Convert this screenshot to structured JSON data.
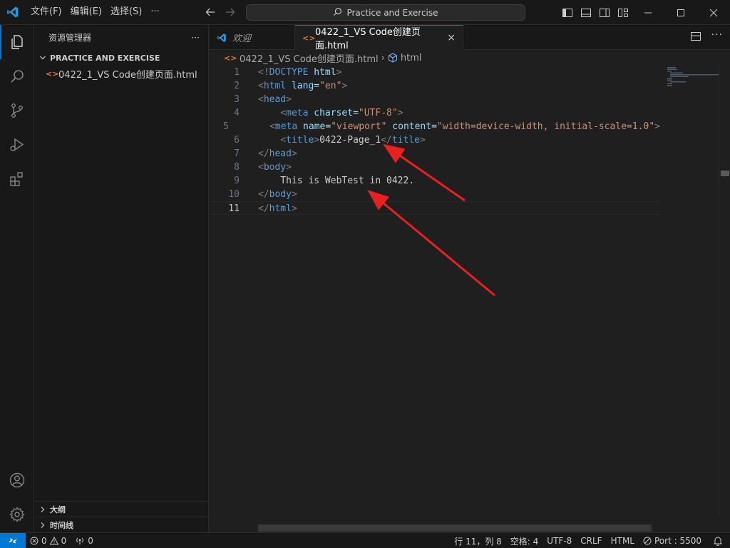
{
  "titlebar": {
    "menus": [
      "文件(F)",
      "编辑(E)",
      "选择(S)",
      "···"
    ],
    "search_text": "Practice and Exercise"
  },
  "sidebar": {
    "title": "资源管理器",
    "more": "···",
    "folder": "PRACTICE AND EXERCISE",
    "files": [
      {
        "icon": "<>",
        "name": "0422_1_VS Code创建页面.html"
      }
    ],
    "outline_label": "大纲",
    "timeline_label": "时间线"
  },
  "tabs": [
    {
      "label": "欢迎",
      "active": false
    },
    {
      "label": "0422_1_VS Code创建页面.html",
      "active": true
    }
  ],
  "breadcrumb": {
    "file": "0422_1_VS Code创建页面.html",
    "symbol": "html"
  },
  "code": {
    "current_line": 11,
    "lines": [
      [
        [
          "tag",
          "<!"
        ],
        [
          "tname",
          "DOCTYPE"
        ],
        [
          "txt",
          " "
        ],
        [
          "attr",
          "html"
        ],
        [
          "tag",
          ">"
        ]
      ],
      [
        [
          "tag",
          "<"
        ],
        [
          "tname",
          "html"
        ],
        [
          "txt",
          " "
        ],
        [
          "attr",
          "lang"
        ],
        [
          "txt",
          "="
        ],
        [
          "str",
          "\"en\""
        ],
        [
          "tag",
          ">"
        ]
      ],
      [
        [
          "tag",
          "<"
        ],
        [
          "tname",
          "head"
        ],
        [
          "tag",
          ">"
        ]
      ],
      [
        [
          "txt",
          "    "
        ],
        [
          "tag",
          "<"
        ],
        [
          "tname",
          "meta"
        ],
        [
          "txt",
          " "
        ],
        [
          "attr",
          "charset"
        ],
        [
          "txt",
          "="
        ],
        [
          "str",
          "\"UTF-8\""
        ],
        [
          "tag",
          ">"
        ]
      ],
      [
        [
          "txt",
          "    "
        ],
        [
          "tag",
          "<"
        ],
        [
          "tname",
          "meta"
        ],
        [
          "txt",
          " "
        ],
        [
          "attr",
          "name"
        ],
        [
          "txt",
          "="
        ],
        [
          "str",
          "\"viewport\""
        ],
        [
          "txt",
          " "
        ],
        [
          "attr",
          "content"
        ],
        [
          "txt",
          "="
        ],
        [
          "str",
          "\"width=device-width, initial-scale=1.0\""
        ],
        [
          "tag",
          ">"
        ]
      ],
      [
        [
          "txt",
          "    "
        ],
        [
          "tag",
          "<"
        ],
        [
          "tname",
          "title"
        ],
        [
          "tag",
          ">"
        ],
        [
          "txt",
          "0422-Page_1"
        ],
        [
          "tag",
          "</"
        ],
        [
          "tname",
          "title"
        ],
        [
          "tag",
          ">"
        ]
      ],
      [
        [
          "tag",
          "</"
        ],
        [
          "tname",
          "head"
        ],
        [
          "tag",
          ">"
        ]
      ],
      [
        [
          "tag",
          "<"
        ],
        [
          "tname",
          "body"
        ],
        [
          "tag",
          ">"
        ]
      ],
      [
        [
          "txt",
          "    This is WebTest in 0422."
        ]
      ],
      [
        [
          "tag",
          "</"
        ],
        [
          "tname",
          "body"
        ],
        [
          "tag",
          ">"
        ]
      ],
      [
        [
          "tag",
          "</"
        ],
        [
          "tname",
          "html"
        ],
        [
          "tag",
          ">"
        ]
      ]
    ]
  },
  "statusbar": {
    "errors": "0",
    "warnings": "0",
    "ports": "0",
    "cursor_position": "行 11，列 8",
    "indent": "空格: 4",
    "encoding": "UTF-8",
    "eol": "CRLF",
    "language": "HTML",
    "port": "Port : 5500"
  },
  "colors": {
    "accent": "#0078d4",
    "arrow": "#e82020",
    "html_file_icon": "#e37933"
  }
}
